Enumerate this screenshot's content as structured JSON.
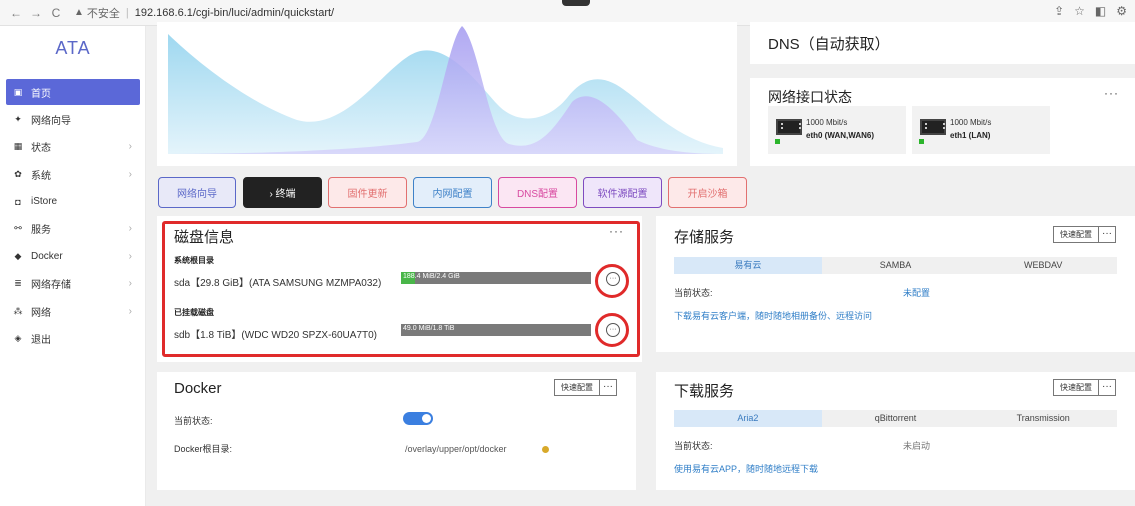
{
  "browser": {
    "nav": [
      "←",
      "→",
      "C"
    ],
    "warn_icon": "▲",
    "insecure": "不安全",
    "sep": "|",
    "url": "192.168.6.1/cgi-bin/luci/admin/quickstart/",
    "right_icons": [
      "⇪",
      "☆",
      "◧",
      "⚙"
    ]
  },
  "sidebar": {
    "logo": "ATA",
    "items": [
      {
        "icon": "▣",
        "label": "首页",
        "chev": ""
      },
      {
        "icon": "✦",
        "label": "网络向导",
        "chev": ""
      },
      {
        "icon": "▦",
        "label": "状态",
        "chev": "›"
      },
      {
        "icon": "✿",
        "label": "系统",
        "chev": "›"
      },
      {
        "icon": "◘",
        "label": "iStore",
        "chev": ""
      },
      {
        "icon": "⚯",
        "label": "服务",
        "chev": "›"
      },
      {
        "icon": "◆",
        "label": "Docker",
        "chev": "›"
      },
      {
        "icon": "≣",
        "label": "网络存储",
        "chev": "›"
      },
      {
        "icon": "⁂",
        "label": "网络",
        "chev": "›"
      },
      {
        "icon": "◈",
        "label": "退出",
        "chev": ""
      }
    ]
  },
  "dns": {
    "title": "DNS（自动获取）"
  },
  "network": {
    "title": "网络接口状态",
    "more": "···",
    "ports": [
      {
        "speed": "1000 Mbit/s",
        "name": "eth0 (WAN,WAN6)"
      },
      {
        "speed": "1000 Mbit/s",
        "name": "eth1 (LAN)"
      }
    ]
  },
  "quick_buttons": [
    {
      "label": "网络向导",
      "color": "#5b68c8",
      "bg": "#e8e9f8"
    },
    {
      "label": "› 终端",
      "color": "#ffffff",
      "bg": "#222222"
    },
    {
      "label": "固件更新",
      "color": "#e27070",
      "bg": "#fde9e9"
    },
    {
      "label": "内网配置",
      "color": "#3f82c8",
      "bg": "#e3eefa"
    },
    {
      "label": "DNS配置",
      "color": "#d84aa0",
      "bg": "#fbe6f3"
    },
    {
      "label": "软件源配置",
      "color": "#7e4cc0",
      "bg": "#efe6fa"
    },
    {
      "label": "开启沙箱",
      "color": "#e27070",
      "bg": "#fde9e9"
    }
  ],
  "disk": {
    "title": "磁盘信息",
    "more": "···",
    "system_label": "系统根目录",
    "sda": {
      "name": "sda【29.8 GiB】(ATA SAMSUNG MZMPA032)",
      "usage": "188.4 MiB/2.4 GiB",
      "fraction": 0.076
    },
    "mounted_label": "已挂载磁盘",
    "sdb": {
      "name": "sdb【1.8 TiB】(WDC WD20 SPZX-60UA7T0)",
      "usage": "49.0 MiB/1.8 TiB",
      "fraction": 0.0
    },
    "circle_more": "···"
  },
  "storage": {
    "title": "存储服务",
    "quick": "快速配置",
    "more": "···",
    "tabs": [
      "易有云",
      "SAMBA",
      "WEBDAV"
    ],
    "status_label": "当前状态:",
    "status_value": "未配置",
    "link": "下载易有云客户端，随时随地相册备份、远程访问"
  },
  "docker": {
    "title": "Docker",
    "quick": "快速配置",
    "more": "···",
    "status_label": "当前状态:",
    "root_label": "Docker根目录:",
    "root_path": "/overlay/upper/opt/docker",
    "enabled": true
  },
  "download": {
    "title": "下载服务",
    "quick": "快速配置",
    "more": "···",
    "tabs": [
      "Aria2",
      "qBittorrent",
      "Transmission"
    ],
    "status_label": "当前状态:",
    "status_value": "未启动",
    "link": "使用易有云APP，随时随地远程下载"
  }
}
